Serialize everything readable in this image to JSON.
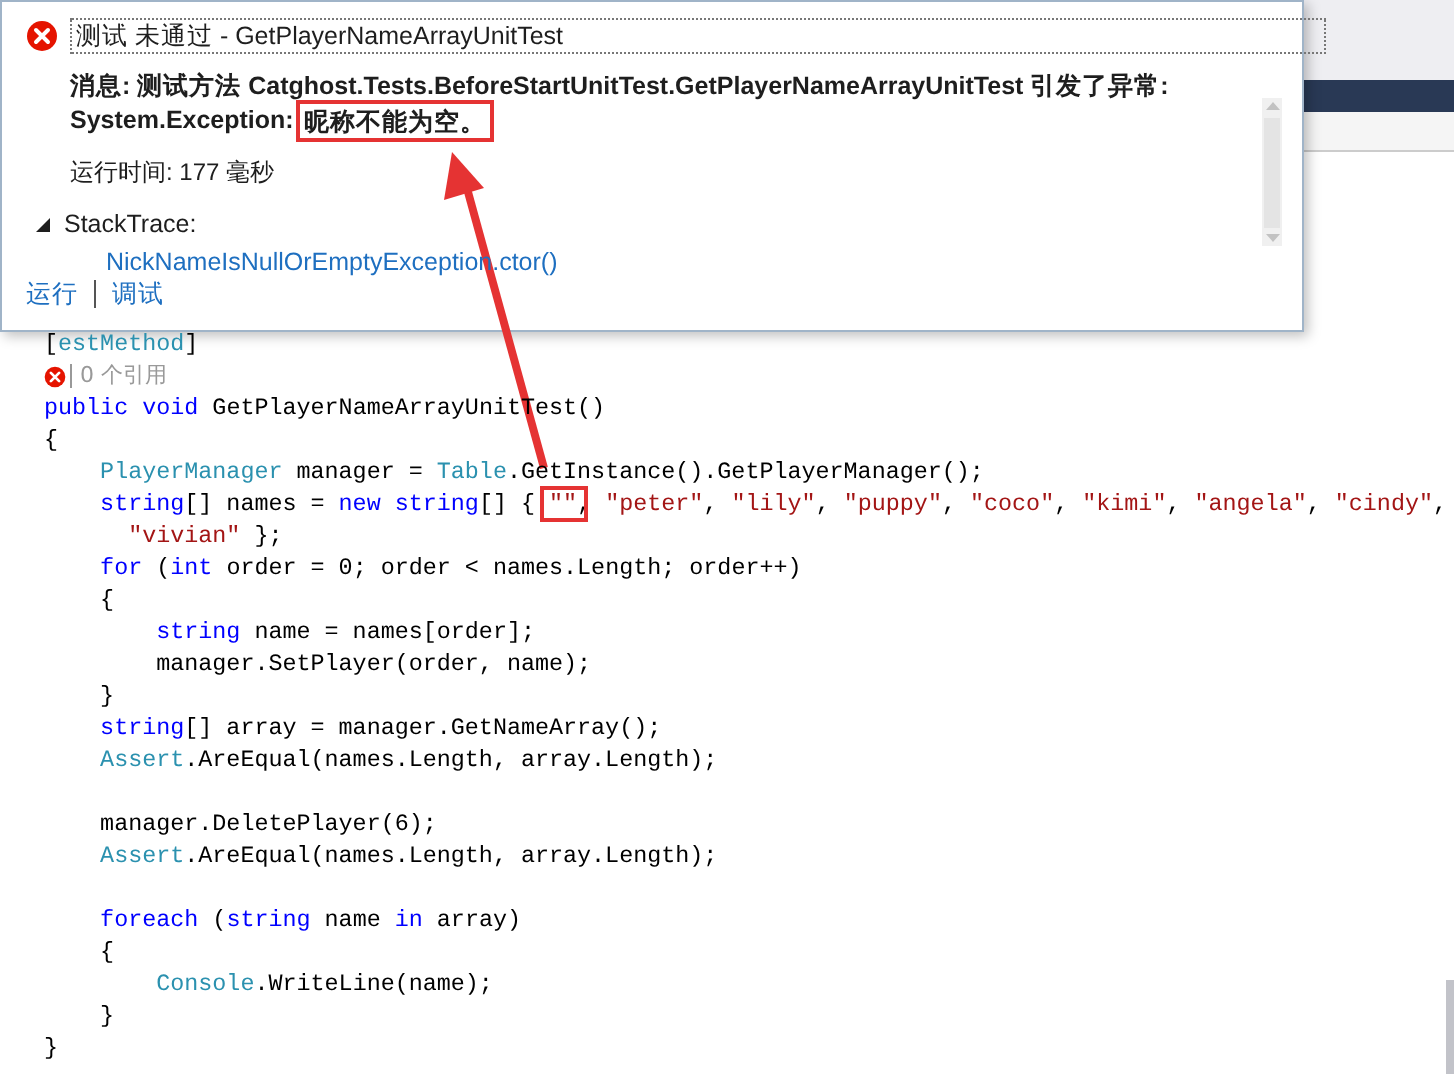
{
  "popup": {
    "title": "测试 未通过 - GetPlayerNameArrayUnitTest",
    "message_line1": "消息: 测试方法 Catghost.Tests.BeforeStartUnitTest.GetPlayerNameArrayUnitTest 引发了异常:",
    "exception_type": "System.Exception:",
    "exception_message": "昵称不能为空。",
    "exception_message_highlighted": true,
    "runtime": "运行时间: 177 毫秒",
    "stacktrace_label": "StackTrace:",
    "stacktrace_expanded": true,
    "stack_frames": [
      "NickNameIsNullOrEmptyException.ctor()"
    ],
    "actions": [
      "运行",
      "调试"
    ]
  },
  "editor": {
    "lines": [
      {
        "kind": "code",
        "tokens": [
          {
            "kind": "plain",
            "text": "["
          },
          {
            "kind": "type",
            "text": "estMethod"
          },
          {
            "kind": "plain",
            "text": "]"
          }
        ]
      },
      {
        "kind": "codelens",
        "failed": true,
        "text": "0 个引用"
      },
      {
        "kind": "code",
        "tokens": [
          {
            "kind": "keyword",
            "text": "public"
          },
          {
            "kind": "keyword",
            "text": " void"
          },
          {
            "kind": "plain",
            "text": " GetPlayerNameArrayUnitTest()"
          }
        ]
      },
      {
        "kind": "code",
        "tokens": [
          {
            "kind": "plain",
            "text": "{"
          }
        ]
      },
      {
        "kind": "code",
        "tokens": [
          {
            "kind": "type",
            "text": "    PlayerManager"
          },
          {
            "kind": "plain",
            "text": " manager = "
          },
          {
            "kind": "type",
            "text": "Table"
          },
          {
            "kind": "plain",
            "text": ".GetInstance().GetPlayerManager();"
          }
        ]
      },
      {
        "kind": "code",
        "tokens": [
          {
            "kind": "keyword",
            "text": "    string"
          },
          {
            "kind": "plain",
            "text": "[] names = "
          },
          {
            "kind": "keyword",
            "text": "new"
          },
          {
            "kind": "keyword",
            "text": " string"
          },
          {
            "kind": "plain",
            "text": "[] { "
          },
          {
            "kind": "string",
            "text": "\"\"",
            "highlighted": true
          },
          {
            "kind": "plain",
            "text": ", "
          },
          {
            "kind": "string",
            "text": "\"peter\""
          },
          {
            "kind": "plain",
            "text": ", "
          },
          {
            "kind": "string",
            "text": "\"lily\""
          },
          {
            "kind": "plain",
            "text": ", "
          },
          {
            "kind": "string",
            "text": "\"puppy\""
          },
          {
            "kind": "plain",
            "text": ", "
          },
          {
            "kind": "string",
            "text": "\"coco\""
          },
          {
            "kind": "plain",
            "text": ", "
          },
          {
            "kind": "string",
            "text": "\"kimi\""
          },
          {
            "kind": "plain",
            "text": ", "
          },
          {
            "kind": "string",
            "text": "\"angela\""
          },
          {
            "kind": "plain",
            "text": ", "
          },
          {
            "kind": "string",
            "text": "\"cindy\""
          },
          {
            "kind": "plain",
            "text": ","
          }
        ]
      },
      {
        "kind": "code",
        "tokens": [
          {
            "kind": "string",
            "text": "      \"vivian\""
          },
          {
            "kind": "plain",
            "text": " };"
          }
        ]
      },
      {
        "kind": "code",
        "tokens": [
          {
            "kind": "keyword",
            "text": "    for"
          },
          {
            "kind": "plain",
            "text": " ("
          },
          {
            "kind": "keyword",
            "text": "int"
          },
          {
            "kind": "plain",
            "text": " order = 0; order < names.Length; order++)"
          }
        ]
      },
      {
        "kind": "code",
        "tokens": [
          {
            "kind": "plain",
            "text": "    {"
          }
        ]
      },
      {
        "kind": "code",
        "tokens": [
          {
            "kind": "keyword",
            "text": "        string"
          },
          {
            "kind": "plain",
            "text": " name = names[order];"
          }
        ]
      },
      {
        "kind": "code",
        "tokens": [
          {
            "kind": "plain",
            "text": "        manager.SetPlayer(order, name);"
          }
        ]
      },
      {
        "kind": "code",
        "tokens": [
          {
            "kind": "plain",
            "text": "    }"
          }
        ]
      },
      {
        "kind": "code",
        "tokens": [
          {
            "kind": "keyword",
            "text": "    string"
          },
          {
            "kind": "plain",
            "text": "[] array = manager.GetNameArray();"
          }
        ]
      },
      {
        "kind": "code",
        "tokens": [
          {
            "kind": "type",
            "text": "    Assert"
          },
          {
            "kind": "plain",
            "text": ".AreEqual(names.Length, array.Length);"
          }
        ]
      },
      {
        "kind": "blank"
      },
      {
        "kind": "code",
        "tokens": [
          {
            "kind": "plain",
            "text": "    manager.DeletePlayer(6);"
          }
        ]
      },
      {
        "kind": "code",
        "tokens": [
          {
            "kind": "type",
            "text": "    Assert"
          },
          {
            "kind": "plain",
            "text": ".AreEqual(names.Length, array.Length);"
          }
        ]
      },
      {
        "kind": "blank"
      },
      {
        "kind": "code",
        "tokens": [
          {
            "kind": "keyword",
            "text": "    foreach"
          },
          {
            "kind": "plain",
            "text": " ("
          },
          {
            "kind": "keyword",
            "text": "string"
          },
          {
            "kind": "plain",
            "text": " name "
          },
          {
            "kind": "keyword",
            "text": "in"
          },
          {
            "kind": "plain",
            "text": " array)"
          }
        ]
      },
      {
        "kind": "code",
        "tokens": [
          {
            "kind": "plain",
            "text": "    {"
          }
        ]
      },
      {
        "kind": "code",
        "tokens": [
          {
            "kind": "type",
            "text": "        Console"
          },
          {
            "kind": "plain",
            "text": ".WriteLine(name);"
          }
        ]
      },
      {
        "kind": "code",
        "tokens": [
          {
            "kind": "plain",
            "text": "    }"
          }
        ]
      },
      {
        "kind": "code",
        "tokens": [
          {
            "kind": "plain",
            "text": "}"
          }
        ]
      }
    ]
  }
}
